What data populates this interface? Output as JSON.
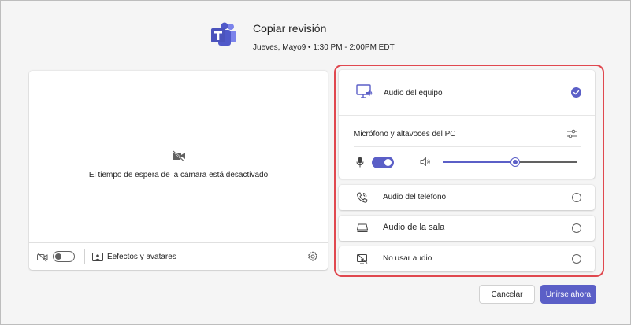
{
  "header": {
    "title": "Copiar revisión",
    "subtitle": "Jueves, Mayo9 • 1:30 PM - 2:00PM EDT",
    "logo_icon": "teams-logo-icon"
  },
  "video": {
    "camera_off_message": "El tiempo de espera de la cámara está desactivado",
    "camera_toggle_on": false,
    "effects_label": "Eefectos y avatares"
  },
  "audio": {
    "device": {
      "label": "Audio del equipo",
      "selected": true,
      "settings_label": "Micrófono y altavoces del PC",
      "mic_on": true,
      "speaker_volume": 0.54
    },
    "options": [
      {
        "label": "Audio del teléfono",
        "icon": "phone-icon",
        "selected": false
      },
      {
        "label": "Audio de la sala",
        "icon": "room-icon",
        "selected": false
      },
      {
        "label": "No usar audio",
        "icon": "no-audio-icon",
        "selected": false
      }
    ]
  },
  "buttons": {
    "cancel_label": "Cancelar",
    "join_label": "Unirse ahora"
  },
  "colors": {
    "accent": "#5b5fc7",
    "highlight": "#e0484f"
  }
}
